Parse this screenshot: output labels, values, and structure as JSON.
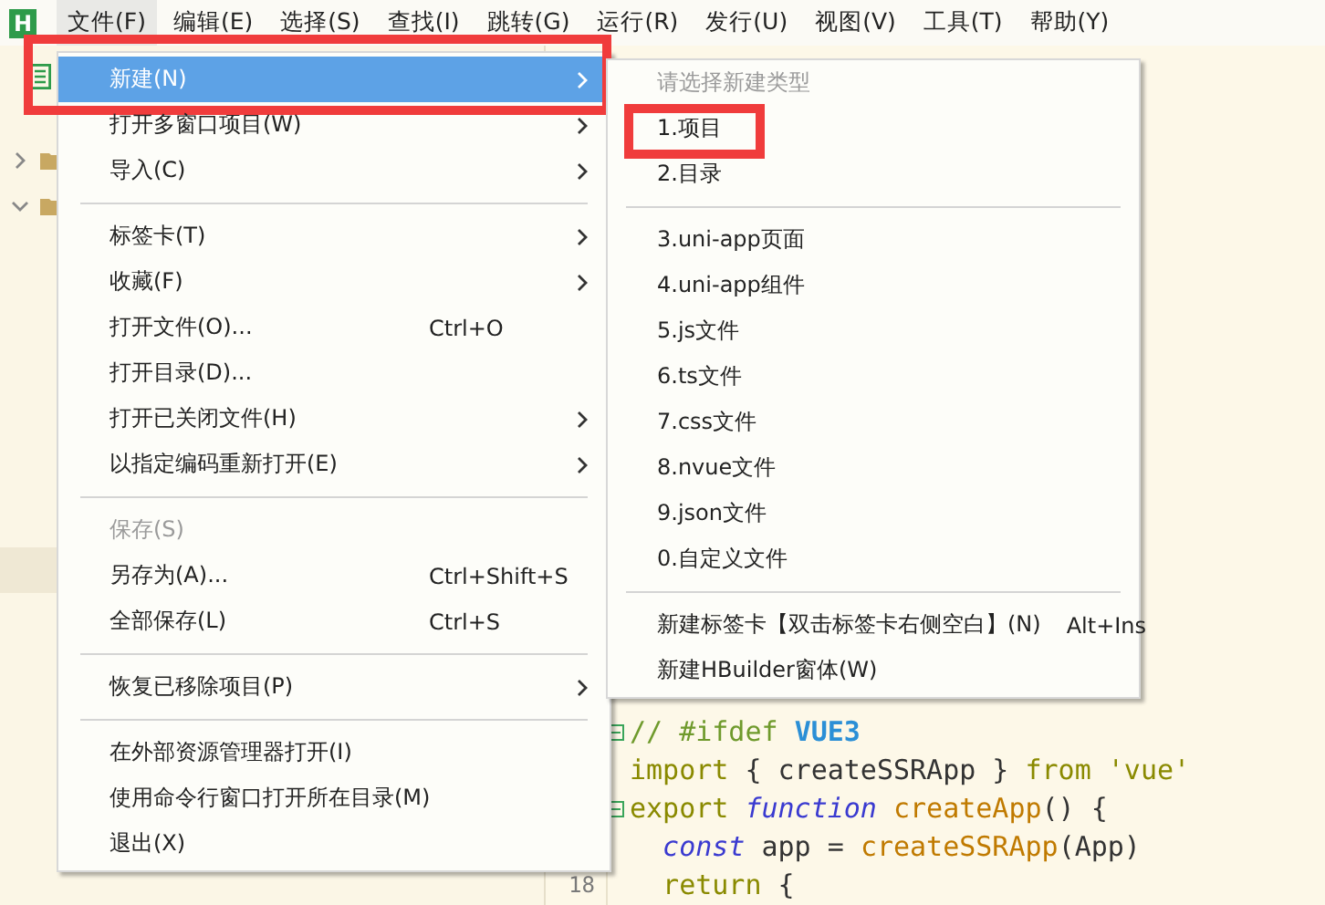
{
  "menubar": {
    "logo": "H",
    "items": [
      {
        "label": "文件(F)",
        "selected": true
      },
      {
        "label": "编辑(E)",
        "selected": false
      },
      {
        "label": "选择(S)",
        "selected": false
      },
      {
        "label": "查找(I)",
        "selected": false
      },
      {
        "label": "跳转(G)",
        "selected": false
      },
      {
        "label": "运行(R)",
        "selected": false
      },
      {
        "label": "发行(U)",
        "selected": false
      },
      {
        "label": "视图(V)",
        "selected": false
      },
      {
        "label": "工具(T)",
        "selected": false
      },
      {
        "label": "帮助(Y)",
        "selected": false
      }
    ]
  },
  "sidebar": {
    "tree": [
      {
        "kind": "folder",
        "expanded": false,
        "selected": false
      },
      {
        "kind": "folder",
        "expanded": true,
        "selected": false
      },
      {
        "kind": "file",
        "selected": true
      }
    ]
  },
  "file_menu": {
    "items": [
      {
        "kind": "item",
        "label": "新建(N)",
        "submenu": true,
        "selected": true,
        "annotated": true
      },
      {
        "kind": "item",
        "label": "打开多窗口项目(W)",
        "submenu": true,
        "selected": false,
        "annotated": false
      },
      {
        "kind": "item",
        "label": "导入(C)",
        "submenu": true,
        "selected": false,
        "annotated": false
      },
      {
        "kind": "separator"
      },
      {
        "kind": "item",
        "label": "标签卡(T)",
        "submenu": true,
        "selected": false,
        "annotated": false
      },
      {
        "kind": "item",
        "label": "收藏(F)",
        "submenu": true,
        "selected": false,
        "annotated": false
      },
      {
        "kind": "item",
        "label": "打开文件(O)...",
        "shortcut": "Ctrl+O",
        "submenu": false,
        "selected": false,
        "annotated": false
      },
      {
        "kind": "item",
        "label": "打开目录(D)...",
        "submenu": false,
        "selected": false,
        "annotated": false
      },
      {
        "kind": "item",
        "label": "打开已关闭文件(H)",
        "submenu": true,
        "selected": false,
        "annotated": false
      },
      {
        "kind": "item",
        "label": "以指定编码重新打开(E)",
        "submenu": true,
        "selected": false,
        "annotated": false
      },
      {
        "kind": "separator"
      },
      {
        "kind": "item",
        "label": "保存(S)",
        "submenu": false,
        "selected": false,
        "annotated": false,
        "disabled": true
      },
      {
        "kind": "item",
        "label": "另存为(A)...",
        "shortcut": "Ctrl+Shift+S",
        "submenu": false,
        "selected": false,
        "annotated": false
      },
      {
        "kind": "item",
        "label": "全部保存(L)",
        "shortcut": "Ctrl+S",
        "submenu": false,
        "selected": false,
        "annotated": false
      },
      {
        "kind": "separator"
      },
      {
        "kind": "item",
        "label": "恢复已移除项目(P)",
        "submenu": true,
        "selected": false,
        "annotated": false
      },
      {
        "kind": "separator"
      },
      {
        "kind": "item",
        "label": "在外部资源管理器打开(I)",
        "submenu": false,
        "selected": false,
        "annotated": false
      },
      {
        "kind": "item",
        "label": "使用命令行窗口打开所在目录(M)",
        "submenu": false,
        "selected": false,
        "annotated": false
      },
      {
        "kind": "item",
        "label": "退出(X)",
        "submenu": false,
        "selected": false,
        "annotated": false
      }
    ]
  },
  "new_submenu": {
    "items": [
      {
        "kind": "heading",
        "label": "请选择新建类型"
      },
      {
        "kind": "item",
        "label": "1.项目",
        "annotated": true
      },
      {
        "kind": "item",
        "label": "2.目录",
        "annotated": false
      },
      {
        "kind": "separator"
      },
      {
        "kind": "item",
        "label": "3.uni-app页面",
        "annotated": false
      },
      {
        "kind": "item",
        "label": "4.uni-app组件",
        "annotated": false
      },
      {
        "kind": "item",
        "label": "5.js文件",
        "annotated": false
      },
      {
        "kind": "item",
        "label": "6.ts文件",
        "annotated": false
      },
      {
        "kind": "item",
        "label": "7.css文件",
        "annotated": false
      },
      {
        "kind": "item",
        "label": "8.nvue文件",
        "annotated": false
      },
      {
        "kind": "item",
        "label": "9.json文件",
        "annotated": false
      },
      {
        "kind": "item",
        "label": "0.自定义文件",
        "annotated": false
      },
      {
        "kind": "separator"
      },
      {
        "kind": "item",
        "label": "新建标签卡【双击标签卡右侧空白】(N)",
        "shortcut": "Alt+Ins",
        "annotated": false
      },
      {
        "kind": "item",
        "label": "新建HBuilder窗体(W)",
        "annotated": false
      }
    ]
  },
  "code": {
    "lines": [
      {
        "foldable": true,
        "tokens": [
          {
            "kind": "comment",
            "text": "// #ifdef "
          },
          {
            "kind": "macro",
            "text": "VUE3"
          }
        ]
      },
      {
        "foldable": false,
        "tokens": [
          {
            "kind": "keyword",
            "text": "import"
          },
          {
            "kind": "plain",
            "text": " { createSSRApp } "
          },
          {
            "kind": "keyword",
            "text": "from"
          },
          {
            "kind": "string",
            "text": " 'vue'"
          }
        ]
      },
      {
        "foldable": true,
        "tokens": [
          {
            "kind": "keyword",
            "text": "export "
          },
          {
            "kind": "storage",
            "text": "function"
          },
          {
            "kind": "call",
            "text": " createApp"
          },
          {
            "kind": "plain",
            "text": "() {"
          }
        ]
      },
      {
        "foldable": false,
        "tokens": [
          {
            "kind": "storage",
            "text": "  const"
          },
          {
            "kind": "plain",
            "text": " app = "
          },
          {
            "kind": "call",
            "text": "createSSRApp"
          },
          {
            "kind": "plain",
            "text": "(App)"
          }
        ]
      },
      {
        "foldable": false,
        "number": "18",
        "tokens": [
          {
            "kind": "keyword",
            "text": "  return"
          },
          {
            "kind": "plain",
            "text": " {"
          }
        ]
      }
    ]
  }
}
